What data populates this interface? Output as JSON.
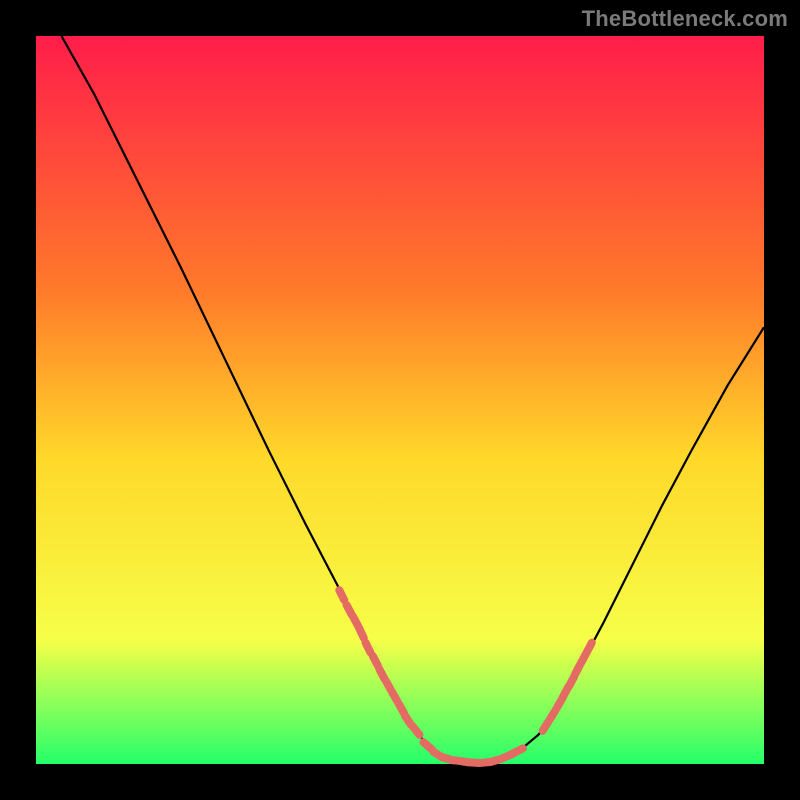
{
  "watermark": {
    "text": "TheBottleneck.com"
  },
  "colors": {
    "bg": "#000000",
    "grad_top": "#ff1d4a",
    "grad_mid1": "#ff7a2a",
    "grad_mid2": "#ffd82a",
    "grad_mid3": "#f6ff48",
    "grad_bottom": "#25ff6a",
    "curve": "#000000",
    "marker": "#e36b63"
  },
  "chart_data": {
    "type": "line",
    "title": "",
    "xlabel": "",
    "ylabel": "",
    "xlim": [
      0,
      1
    ],
    "ylim": [
      0,
      1
    ],
    "curve_left": [
      {
        "x": 0.035,
        "y": 1.0
      },
      {
        "x": 0.08,
        "y": 0.92
      },
      {
        "x": 0.14,
        "y": 0.8
      },
      {
        "x": 0.2,
        "y": 0.68
      },
      {
        "x": 0.26,
        "y": 0.555
      },
      {
        "x": 0.32,
        "y": 0.43
      },
      {
        "x": 0.37,
        "y": 0.33
      },
      {
        "x": 0.418,
        "y": 0.238
      },
      {
        "x": 0.445,
        "y": 0.186
      },
      {
        "x": 0.47,
        "y": 0.135
      },
      {
        "x": 0.492,
        "y": 0.094
      },
      {
        "x": 0.51,
        "y": 0.062
      },
      {
        "x": 0.526,
        "y": 0.04
      },
      {
        "x": 0.54,
        "y": 0.023
      },
      {
        "x": 0.555,
        "y": 0.011
      },
      {
        "x": 0.57,
        "y": 0.005
      },
      {
        "x": 0.59,
        "y": 0.003
      }
    ],
    "curve_right": [
      {
        "x": 0.59,
        "y": 0.003
      },
      {
        "x": 0.61,
        "y": 0.002
      },
      {
        "x": 0.63,
        "y": 0.004
      },
      {
        "x": 0.66,
        "y": 0.015
      },
      {
        "x": 0.69,
        "y": 0.04
      },
      {
        "x": 0.7,
        "y": 0.052
      },
      {
        "x": 0.718,
        "y": 0.08
      },
      {
        "x": 0.74,
        "y": 0.12
      },
      {
        "x": 0.78,
        "y": 0.195
      },
      {
        "x": 0.82,
        "y": 0.275
      },
      {
        "x": 0.86,
        "y": 0.355
      },
      {
        "x": 0.9,
        "y": 0.43
      },
      {
        "x": 0.95,
        "y": 0.52
      },
      {
        "x": 1.0,
        "y": 0.6
      }
    ],
    "markers_left": [
      {
        "x": 0.42,
        "y": 0.232
      },
      {
        "x": 0.43,
        "y": 0.212
      },
      {
        "x": 0.439,
        "y": 0.196
      },
      {
        "x": 0.447,
        "y": 0.18
      },
      {
        "x": 0.456,
        "y": 0.16
      },
      {
        "x": 0.466,
        "y": 0.142
      },
      {
        "x": 0.475,
        "y": 0.124
      },
      {
        "x": 0.484,
        "y": 0.108
      },
      {
        "x": 0.493,
        "y": 0.092
      },
      {
        "x": 0.502,
        "y": 0.076
      },
      {
        "x": 0.511,
        "y": 0.06
      },
      {
        "x": 0.522,
        "y": 0.046
      }
    ],
    "markers_bottom": [
      {
        "x": 0.538,
        "y": 0.025
      },
      {
        "x": 0.552,
        "y": 0.013
      },
      {
        "x": 0.566,
        "y": 0.007
      },
      {
        "x": 0.583,
        "y": 0.004
      },
      {
        "x": 0.6,
        "y": 0.002
      },
      {
        "x": 0.616,
        "y": 0.002
      },
      {
        "x": 0.632,
        "y": 0.005
      },
      {
        "x": 0.648,
        "y": 0.011
      },
      {
        "x": 0.662,
        "y": 0.018
      }
    ],
    "markers_right": [
      {
        "x": 0.7,
        "y": 0.052
      },
      {
        "x": 0.71,
        "y": 0.068
      },
      {
        "x": 0.72,
        "y": 0.085
      },
      {
        "x": 0.728,
        "y": 0.1
      },
      {
        "x": 0.736,
        "y": 0.114
      },
      {
        "x": 0.744,
        "y": 0.13
      },
      {
        "x": 0.752,
        "y": 0.145
      },
      {
        "x": 0.76,
        "y": 0.16
      }
    ]
  }
}
